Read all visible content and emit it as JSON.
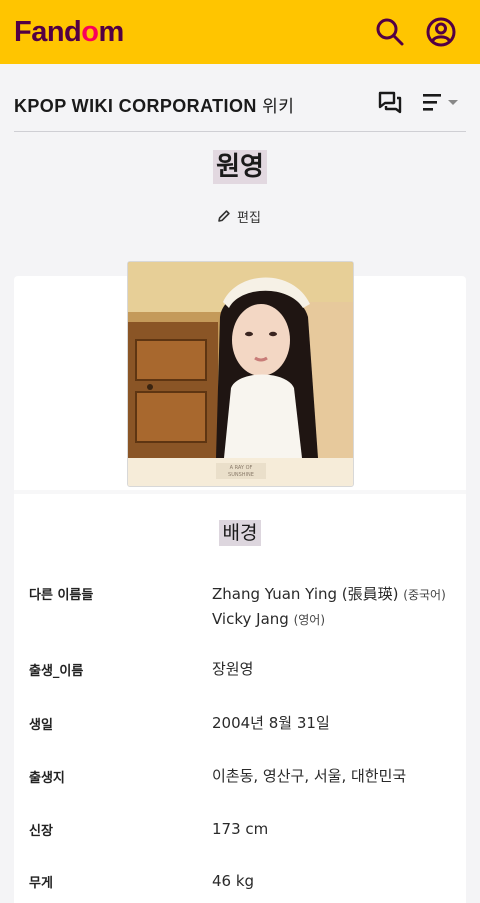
{
  "header": {
    "logo_pre": "Fand",
    "logo_mid": "o",
    "logo_post": "m",
    "brand_color": "#ffc500",
    "logo_color": "#520044",
    "accent_color": "#fa005a"
  },
  "wiki": {
    "name": "KPOP WIKI CORPORATION",
    "suffix": "위키"
  },
  "page": {
    "title": "원영",
    "edit_label": "편집"
  },
  "infobox": {
    "image": {
      "caption_line1": "A RAY OF",
      "caption_line2": "SUNSHINE"
    },
    "section_title": "배경",
    "rows": [
      {
        "label": "다른 이름들",
        "value1": "Zhang Yuan Ying (張員瑛)",
        "note1": "(중국어)",
        "value2": "Vicky Jang",
        "note2": "(영어)"
      },
      {
        "label": "출생_이름",
        "value": "장원영"
      },
      {
        "label": "생일",
        "value": "2004년 8월 31일"
      },
      {
        "label": "출생지",
        "value": "이촌동, 영산구, 서울, 대한민국"
      },
      {
        "label": "신장",
        "value": "173 cm"
      },
      {
        "label": "무게",
        "value": "46 kg"
      }
    ]
  }
}
